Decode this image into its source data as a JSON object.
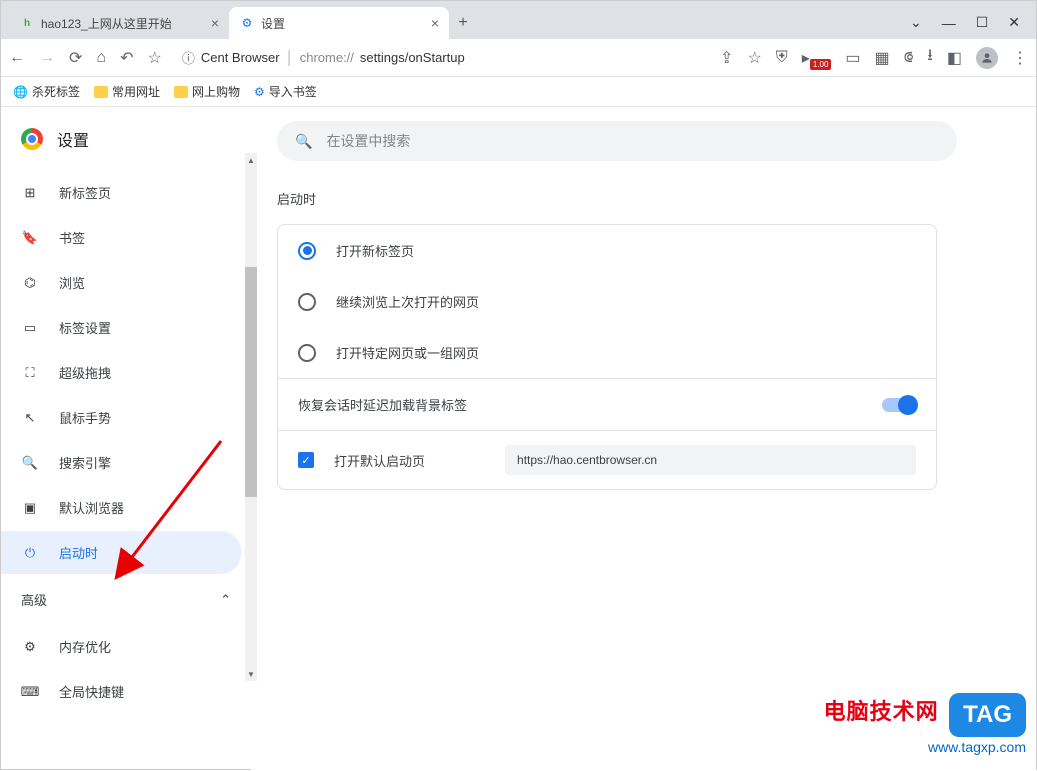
{
  "window": {
    "minimize": "—",
    "maximize": "☐",
    "close": "✕",
    "dropdown": "⌄"
  },
  "tabs": [
    {
      "title": "hao123_上网从这里开始",
      "favicon": "hao"
    },
    {
      "title": "设置",
      "favicon": "gear"
    }
  ],
  "new_tab": "+",
  "omnibox": {
    "brand": "Cent Browser",
    "url_proto": "chrome://",
    "url_path": "settings/onStartup"
  },
  "right_badge": "1.00",
  "bookmarks": [
    {
      "label": "杀死标签",
      "icon": "globe"
    },
    {
      "label": "常用网址",
      "icon": "folder"
    },
    {
      "label": "网上购物",
      "icon": "folder"
    },
    {
      "label": "导入书签",
      "icon": "gear"
    }
  ],
  "sidebar": {
    "title": "设置",
    "items": [
      {
        "icon": "plus-box",
        "label": "新标签页"
      },
      {
        "icon": "bookmark",
        "label": "书签"
      },
      {
        "icon": "browse",
        "label": "浏览"
      },
      {
        "icon": "tab",
        "label": "标签设置"
      },
      {
        "icon": "expand",
        "label": "超级拖拽"
      },
      {
        "icon": "cursor",
        "label": "鼠标手势"
      },
      {
        "icon": "search",
        "label": "搜索引擎"
      },
      {
        "icon": "window",
        "label": "默认浏览器"
      },
      {
        "icon": "power",
        "label": "启动时",
        "selected": true
      }
    ],
    "advanced": "高级",
    "extra": [
      {
        "icon": "gear",
        "label": "内存优化"
      },
      {
        "icon": "keyboard",
        "label": "全局快捷键"
      }
    ]
  },
  "search_placeholder": "在设置中搜索",
  "section": {
    "title": "启动时",
    "radios": [
      {
        "label": "打开新标签页",
        "checked": true
      },
      {
        "label": "继续浏览上次打开的网页",
        "checked": false
      },
      {
        "label": "打开特定网页或一组网页",
        "checked": false
      }
    ],
    "toggle_label": "恢复会话时延迟加载背景标签",
    "checkbox_label": "打开默认启动页",
    "url_value": "https://hao.centbrowser.cn"
  },
  "watermark": {
    "text": "电脑技术网",
    "url": "www.tagxp.com",
    "tag": "TAG"
  }
}
